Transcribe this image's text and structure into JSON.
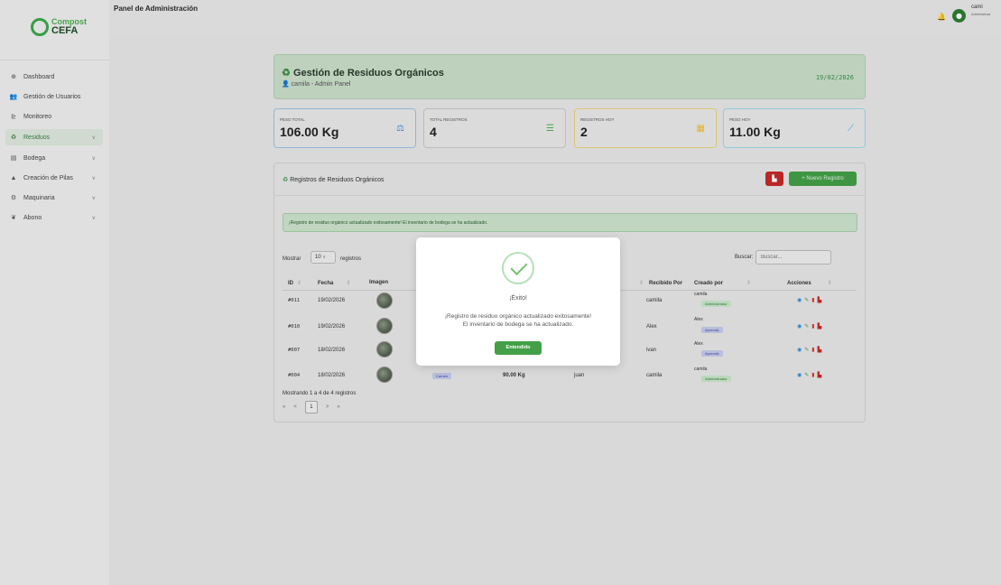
{
  "logo": {
    "line1": "Compost",
    "line2": "CEFA"
  },
  "sidebar": {
    "items": [
      {
        "label": "Dashboard",
        "icon": "dashboard-icon",
        "glyph": "⊕"
      },
      {
        "label": "Gestión de Usuarios",
        "icon": "users-icon",
        "glyph": "👥"
      },
      {
        "label": "Monitoreo",
        "icon": "chart-line-icon",
        "glyph": "⊵"
      },
      {
        "label": "Residuos",
        "icon": "recycle-icon",
        "glyph": "♻",
        "active": true,
        "chevron": "∨"
      },
      {
        "label": "Bodega",
        "icon": "warehouse-icon",
        "glyph": "▤",
        "chevron": "∨"
      },
      {
        "label": "Creación de Pilas",
        "icon": "pile-icon",
        "glyph": "▲",
        "chevron": "∨"
      },
      {
        "label": "Maquinaria",
        "icon": "cogs-icon",
        "glyph": "⚙",
        "chevron": "∨"
      },
      {
        "label": "Abono",
        "icon": "seedling-icon",
        "glyph": "❦",
        "chevron": "∨"
      }
    ]
  },
  "topbar": {
    "title": "Panel de Administración",
    "user_name": "cami",
    "user_role": "Administrad"
  },
  "header": {
    "title": "Gestión de Residuos Orgánicos",
    "subtitle": "camila - Admin Panel",
    "date": "19/02/2026"
  },
  "stats": [
    {
      "label": "PESO TOTAL",
      "value": "106.00 Kg",
      "icon": "weight-icon",
      "color": "#2196f3"
    },
    {
      "label": "TOTAL REGISTROS",
      "value": "4",
      "icon": "list-icon",
      "color": "#4caf50"
    },
    {
      "label": "REGISTROS HOY",
      "value": "2",
      "icon": "calendar-icon",
      "color": "#fbc02d"
    },
    {
      "label": "PESO HOY",
      "value": "11.00 Kg",
      "icon": "chart-area-icon",
      "color": "#29b6f6"
    }
  ],
  "panel": {
    "title": "Registros de Residuos Orgánicos",
    "new_button": "+ Nuevo Registro",
    "alert": "¡Registro de residuo orgánico actualizado exitosamente! El inventario de bodega se ha actualizado.",
    "show_label": "Mostrar",
    "show_value": "10",
    "records_label": "registros",
    "search_label": "Buscar:",
    "search_placeholder": "Buscar...",
    "columns": [
      "ID",
      "Fecha",
      "Imagen",
      "Recibido Por",
      "Creado por",
      "Acciones"
    ],
    "rows": [
      {
        "id": "#011",
        "fecha": "19/02/2026",
        "recibido": "camila",
        "creado": "camila",
        "rol": "Administrador"
      },
      {
        "id": "#010",
        "fecha": "19/02/2026",
        "recibido": "Alex",
        "creado": "Alex",
        "rol": "Aprendiz"
      },
      {
        "id": "#007",
        "fecha": "18/02/2026",
        "recibido": "ivan",
        "creado": "Alex",
        "rol": "Aprendiz"
      },
      {
        "id": "#004",
        "fecha": "18/02/2026",
        "tipo": "Carnes",
        "peso": "90.00 Kg",
        "entregado": "juan",
        "recibido": "camila",
        "creado": "camila",
        "rol": "Administrador"
      }
    ],
    "footer": "Mostrando 1 a 4 de 4 registros",
    "pager": {
      "first": "«",
      "prev": "<",
      "current": "1",
      "next": ">",
      "last": "»"
    }
  },
  "modal": {
    "title": "¡Éxito!",
    "line1": "¡Registro de residuo orgánico actualizado exitosamente!",
    "line2": "El inventario de bodega se ha actualizado.",
    "button": "Entendido"
  }
}
